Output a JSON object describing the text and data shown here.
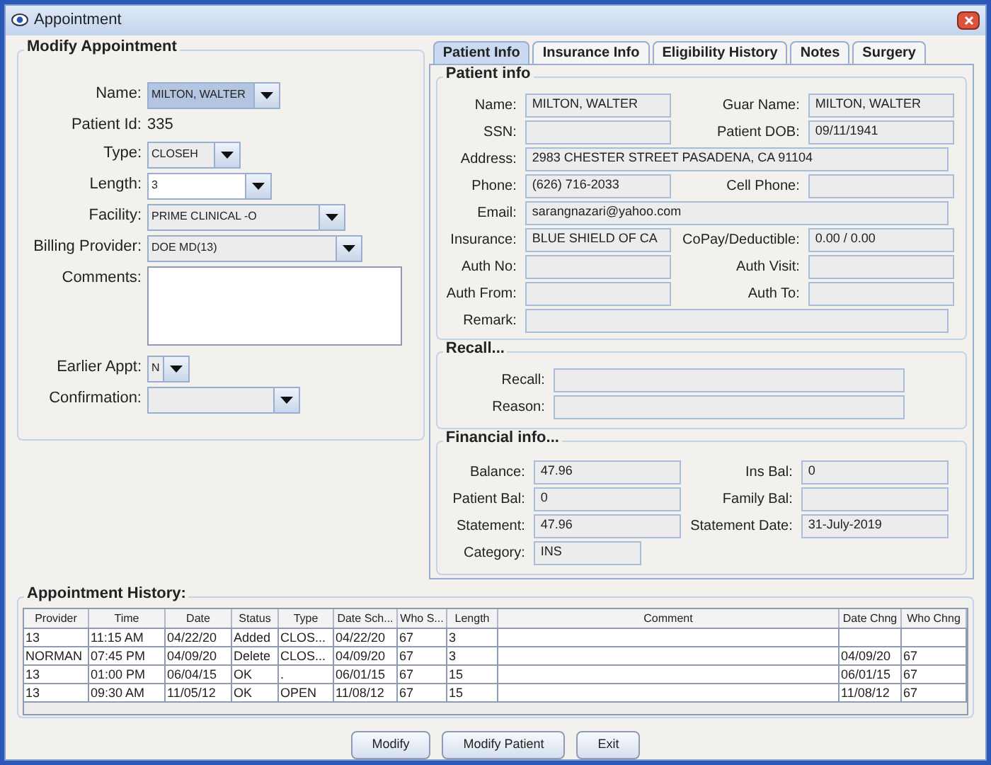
{
  "window": {
    "title": "Appointment"
  },
  "modify_appointment": {
    "title": "Modify Appointment",
    "fields": [
      {
        "kind": "combo",
        "label": "Name:",
        "value": "MILTON, WALTER",
        "highlighted": true,
        "editable": false
      },
      {
        "kind": "text",
        "label": "Patient Id:",
        "value": "335"
      },
      {
        "kind": "combo",
        "label": "Type:",
        "value": "CLOSEH",
        "highlighted": false,
        "editable": false
      },
      {
        "kind": "combo",
        "label": "Length:",
        "value": "3",
        "highlighted": false,
        "editable": true
      },
      {
        "kind": "combo",
        "label": "Facility:",
        "value": "PRIME CLINICAL -O",
        "highlighted": false,
        "editable": false
      },
      {
        "kind": "combo",
        "label": "Billing Provider:",
        "value": "DOE MD(13)",
        "highlighted": false,
        "editable": false
      },
      {
        "kind": "area",
        "label": "Comments:"
      },
      {
        "kind": "combo",
        "label": "Earlier Appt:",
        "value": "N",
        "highlighted": false,
        "editable": false
      },
      {
        "kind": "combo",
        "label": "Confirmation:",
        "highlighted": false,
        "editable": false
      }
    ]
  },
  "tabs": [
    {
      "label": "Patient Info",
      "selected": true
    },
    {
      "label": "Insurance Info",
      "selected": false
    },
    {
      "label": "Eligibility History",
      "selected": false
    },
    {
      "label": "Notes",
      "selected": false
    },
    {
      "label": "Surgery",
      "selected": false
    }
  ],
  "patient_info": {
    "title": "Patient info",
    "rows": [
      [
        {
          "label": "Name:",
          "value": "MILTON, WALTER"
        },
        {
          "label": "Guar Name:",
          "value": "MILTON, WALTER"
        }
      ],
      [
        {
          "label": "SSN:"
        },
        {
          "label": "Patient DOB:",
          "value": "09/11/1941"
        }
      ],
      [
        {
          "label": "Address:",
          "value": "2983 CHESTER STREET PASADENA, CA 91104"
        }
      ],
      [
        {
          "label": "Phone:",
          "value": "(626) 716-2033"
        },
        {
          "label": "Cell Phone:"
        }
      ],
      [
        {
          "label": "Email:",
          "value": "sarangnazari@yahoo.com"
        }
      ],
      [
        {
          "label": "Insurance:",
          "value": "BLUE SHIELD OF CA"
        },
        {
          "label": "CoPay/Deductible:",
          "value": "0.00  /  0.00"
        }
      ],
      [
        {
          "label": "Auth No:"
        },
        {
          "label": "Auth Visit:"
        }
      ],
      [
        {
          "label": "Auth From:"
        },
        {
          "label": "Auth To:"
        }
      ],
      [
        {
          "label": "Remark:"
        }
      ]
    ]
  },
  "recall": {
    "title": "Recall...",
    "rows": [
      {
        "label": "Recall:"
      },
      {
        "label": "Reason:"
      }
    ]
  },
  "financial_info": {
    "title": "Financial info...",
    "rows": [
      [
        {
          "label": "Balance:",
          "value": "47.96"
        },
        {
          "label": "Ins Bal:",
          "value": "0"
        }
      ],
      [
        {
          "label": "Patient Bal:",
          "value": "0"
        },
        {
          "label": "Family Bal:"
        }
      ],
      [
        {
          "label": "Statement:",
          "value": "47.96"
        },
        {
          "label": "Statement Date:",
          "value": "31-July-2019"
        }
      ],
      [
        {
          "label": "Category:",
          "value": "INS"
        }
      ]
    ]
  },
  "appointment_history": {
    "title": "Appointment History:",
    "columns": [
      "Provider",
      "Time",
      "Date",
      "Status",
      "Type",
      "Date Sch...",
      "Who S...",
      "Length",
      "Comment",
      "Date Chng",
      "Who Chng"
    ],
    "rows": [
      [
        "13",
        "11:15 AM",
        "04/22/20",
        "Added",
        "CLOS...",
        "04/22/20",
        "67",
        "3",
        "",
        "",
        ""
      ],
      [
        "NORMAN",
        "07:45 PM",
        "04/09/20",
        "Delete",
        "CLOS...",
        "04/09/20",
        "67",
        "3",
        "",
        "04/09/20",
        "67"
      ],
      [
        "13",
        "01:00 PM",
        "06/04/15",
        "OK",
        ".",
        "06/01/15",
        "67",
        "15",
        "",
        "06/01/15",
        "67"
      ],
      [
        "13",
        "09:30 AM",
        "11/05/12",
        "OK",
        "OPEN",
        "11/08/12",
        "67",
        "15",
        "",
        "11/08/12",
        "67"
      ]
    ]
  },
  "buttons": [
    "Modify",
    "Modify Patient",
    "Exit"
  ]
}
